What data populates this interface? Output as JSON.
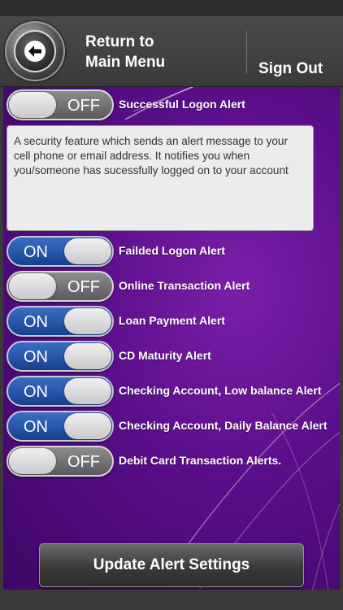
{
  "header": {
    "back_label": "Return to\nMain Menu",
    "signout_label": "Sign Out"
  },
  "alerts": [
    {
      "label": "Successful Logon Alert",
      "state": "OFF"
    },
    {
      "label": "Failded Logon Alert",
      "state": "ON"
    },
    {
      "label": "Online Transaction Alert",
      "state": "OFF"
    },
    {
      "label": "Loan Payment Alert",
      "state": "ON"
    },
    {
      "label": "CD Maturity Alert",
      "state": "ON"
    },
    {
      "label": "Checking Account, Low balance Alert",
      "state": "ON"
    },
    {
      "label": "Checking Account, Daily Balance Alert",
      "state": "ON"
    },
    {
      "label": "Debit Card Transaction Alerts.",
      "state": "OFF"
    }
  ],
  "description": "A security feature which sends an alert message to your cell phone or email address. It notifies you when you/someone has sucessfully logged on to your account",
  "update_label": "Update Alert Settings",
  "icons": {
    "back": "back-arrow-icon"
  },
  "colors": {
    "on_toggle": "#2a5bb0",
    "off_toggle": "#777777",
    "background": "#5a0e8a"
  }
}
